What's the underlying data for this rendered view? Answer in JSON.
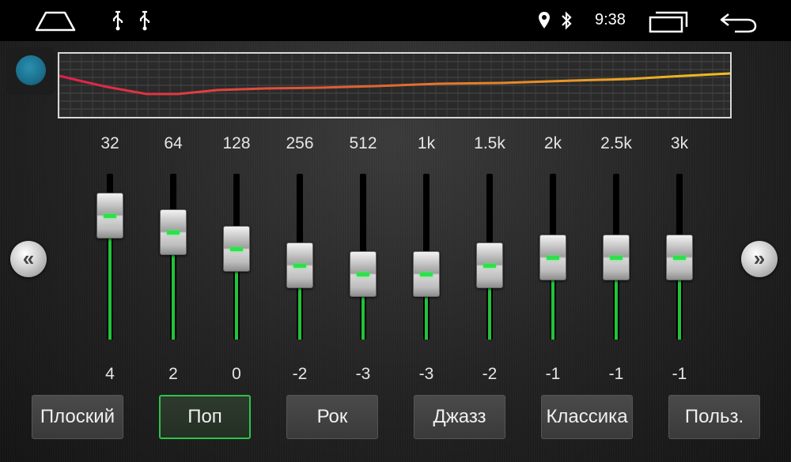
{
  "status": {
    "time": "9:38",
    "usb_icons": [
      "usb-icon",
      "usb-icon"
    ]
  },
  "graph": {
    "grid": true,
    "curve_color_start": "#e0204a",
    "curve_color_end": "#f0c020"
  },
  "bands": [
    {
      "freq": "32",
      "value": "4",
      "level": 4
    },
    {
      "freq": "64",
      "value": "2",
      "level": 2
    },
    {
      "freq": "128",
      "value": "0",
      "level": 0
    },
    {
      "freq": "256",
      "value": "-2",
      "level": -2
    },
    {
      "freq": "512",
      "value": "-3",
      "level": -3
    },
    {
      "freq": "1k",
      "value": "-3",
      "level": -3
    },
    {
      "freq": "1.5k",
      "value": "-2",
      "level": -2
    },
    {
      "freq": "2k",
      "value": "-1",
      "level": -1
    },
    {
      "freq": "2.5k",
      "value": "-1",
      "level": -1
    },
    {
      "freq": "3k",
      "value": "-1",
      "level": -1
    }
  ],
  "level_range": [
    -10,
    10
  ],
  "presets": [
    {
      "label": "Плоский",
      "active": false
    },
    {
      "label": "Поп",
      "active": true
    },
    {
      "label": "Рок",
      "active": false
    },
    {
      "label": "Джазз",
      "active": false
    },
    {
      "label": "Классика",
      "active": false
    },
    {
      "label": "Польз.",
      "active": false
    }
  ],
  "colors": {
    "accent": "#2ec44a",
    "fill": "#22c23a"
  }
}
